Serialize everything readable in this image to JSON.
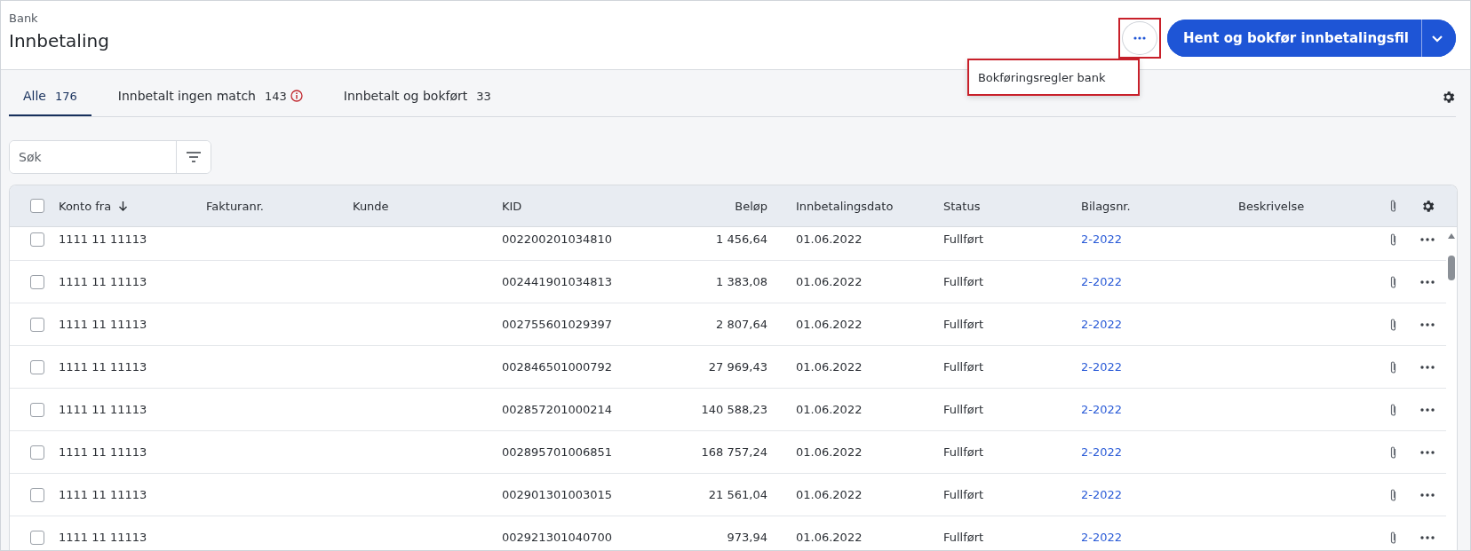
{
  "breadcrumb": "Bank",
  "title": "Innbetaling",
  "primary_button": {
    "label": "Hent og bokfør innbetalingsfil"
  },
  "more_menu": {
    "items": [
      "Bokføringsregler bank"
    ]
  },
  "tabs": [
    {
      "label": "Alle",
      "count": "176",
      "selected": true,
      "warning": false
    },
    {
      "label": "Innbetalt ingen match",
      "count": "143",
      "selected": false,
      "warning": true
    },
    {
      "label": "Innbetalt og bokført",
      "count": "33",
      "selected": false,
      "warning": false
    }
  ],
  "search": {
    "placeholder": "Søk"
  },
  "table": {
    "select_all_checked": false,
    "columns": [
      {
        "label": "Konto fra",
        "sorted": true
      },
      {
        "label": "Fakturanr.",
        "sorted": false
      },
      {
        "label": "Kunde",
        "sorted": false
      },
      {
        "label": "KID",
        "sorted": false
      },
      {
        "label": "Beløp",
        "sorted": false
      },
      {
        "label": "Innbetalingsdato",
        "sorted": false
      },
      {
        "label": "Status",
        "sorted": false
      },
      {
        "label": "Bilagsnr.",
        "sorted": false
      },
      {
        "label": "Beskrivelse",
        "sorted": false
      }
    ],
    "rows": [
      {
        "checked": false,
        "konto": "1111 11 11113",
        "kid": "002200201034810",
        "belop": "1 456,64",
        "dato": "01.06.2022",
        "status": "Fullført",
        "bilag": "2-2022"
      },
      {
        "checked": false,
        "konto": "1111 11 11113",
        "kid": "002441901034813",
        "belop": "1 383,08",
        "dato": "01.06.2022",
        "status": "Fullført",
        "bilag": "2-2022"
      },
      {
        "checked": false,
        "konto": "1111 11 11113",
        "kid": "002755601029397",
        "belop": "2 807,64",
        "dato": "01.06.2022",
        "status": "Fullført",
        "bilag": "2-2022"
      },
      {
        "checked": false,
        "konto": "1111 11 11113",
        "kid": "002846501000792",
        "belop": "27 969,43",
        "dato": "01.06.2022",
        "status": "Fullført",
        "bilag": "2-2022"
      },
      {
        "checked": false,
        "konto": "1111 11 11113",
        "kid": "002857201000214",
        "belop": "140 588,23",
        "dato": "01.06.2022",
        "status": "Fullført",
        "bilag": "2-2022"
      },
      {
        "checked": false,
        "konto": "1111 11 11113",
        "kid": "002895701006851",
        "belop": "168 757,24",
        "dato": "01.06.2022",
        "status": "Fullført",
        "bilag": "2-2022"
      },
      {
        "checked": false,
        "konto": "1111 11 11113",
        "kid": "002901301003015",
        "belop": "21 561,04",
        "dato": "01.06.2022",
        "status": "Fullført",
        "bilag": "2-2022"
      },
      {
        "checked": false,
        "konto": "1111 11 11113",
        "kid": "002921301040700",
        "belop": "973,94",
        "dato": "01.06.2022",
        "status": "Fullført",
        "bilag": "2-2022"
      }
    ]
  }
}
